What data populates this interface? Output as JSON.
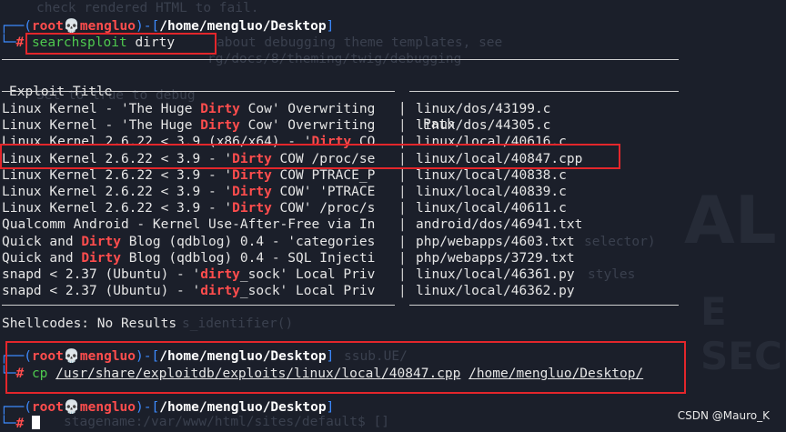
{
  "background_overlay": [
    {
      "text": "check rendered HTML to fail."
    },
    {
      "text": "about debugging theme templates, see"
    },
    {
      "text": "rg/docs/8/theming/twig/debugging"
    },
    {
      "text": "Set to true to debug"
    },
    {
      "text": "selector)"
    },
    {
      "text": "styles"
    },
    {
      "text": "s_identifier()"
    },
    {
      "text": "ssub.UE/"
    },
    {
      "text": "stagename:/var/www/html/sites/default$ []"
    }
  ],
  "background_brand": [
    "AL",
    "E SECU"
  ],
  "prompt1": {
    "user": "root",
    "host": "mengluo",
    "path": "/home/mengluo/Desktop",
    "command": "searchsploit",
    "args": "dirty"
  },
  "results": {
    "header_title": "Exploit Title",
    "header_path": "Path",
    "rows": [
      {
        "pre": "Linux Kernel - 'The Huge ",
        "hl": "Dirty",
        "post": " Cow' Overwriting",
        "path": "linux/dos/43199.c"
      },
      {
        "pre": "Linux Kernel - 'The Huge ",
        "hl": "Dirty",
        "post": " Cow' Overwriting",
        "path": "linux/dos/44305.c"
      },
      {
        "pre": "Linux Kernel 2.6.22 < 3.9 (x86/x64) - '",
        "hl": "Dirty",
        "post": " CO",
        "path": "linux/local/40616.c"
      },
      {
        "pre": "Linux Kernel 2.6.22 < 3.9 - '",
        "hl": "Dirty",
        "post": " COW /proc/se",
        "path": "linux/local/40847.cpp"
      },
      {
        "pre": "Linux Kernel 2.6.22 < 3.9 - '",
        "hl": "Dirty",
        "post": " COW PTRACE_P",
        "path": "linux/local/40838.c"
      },
      {
        "pre": "Linux Kernel 2.6.22 < 3.9 - '",
        "hl": "Dirty",
        "post": " COW' 'PTRACE",
        "path": "linux/local/40839.c"
      },
      {
        "pre": "Linux Kernel 2.6.22 < 3.9 - '",
        "hl": "Dirty",
        "post": " COW' /proc/s",
        "path": "linux/local/40611.c"
      },
      {
        "pre": "Qualcomm Android - Kernel Use-After-Free via In",
        "hl": "",
        "post": "",
        "path": "android/dos/46941.txt"
      },
      {
        "pre": "Quick and ",
        "hl": "Dirty",
        "post": " Blog (qdblog) 0.4 - 'categories",
        "path": "php/webapps/4603.txt"
      },
      {
        "pre": "Quick and ",
        "hl": "Dirty",
        "post": " Blog (qdblog) 0.4 - SQL Injecti",
        "path": "php/webapps/3729.txt"
      },
      {
        "pre": "snapd < 2.37 (Ubuntu) - '",
        "hl": "dirty",
        "post": "_sock' Local Priv",
        "path": "linux/local/46361.py"
      },
      {
        "pre": "snapd < 2.37 (Ubuntu) - '",
        "hl": "dirty",
        "post": "_sock' Local Priv",
        "path": "linux/local/46362.py"
      }
    ],
    "shellcodes": "Shellcodes: No Results"
  },
  "prompt2": {
    "user": "root",
    "host": "mengluo",
    "path": "/home/mengluo/Desktop",
    "command": "cp",
    "src": "/usr/share/exploitdb/exploits/linux/local/40847.cpp",
    "dst": "/home/mengluo/Desktop/"
  },
  "prompt3": {
    "user": "root",
    "host": "mengluo",
    "path": "/home/mengluo/Desktop"
  },
  "watermark": "CSDN @Mauro_K",
  "colors": {
    "background": "#1b1f2a",
    "prompt_blue": "#3d8bff",
    "root_red": "#ff4d4d",
    "command_green": "#4ec94e",
    "annotation_red": "#e3262b"
  }
}
